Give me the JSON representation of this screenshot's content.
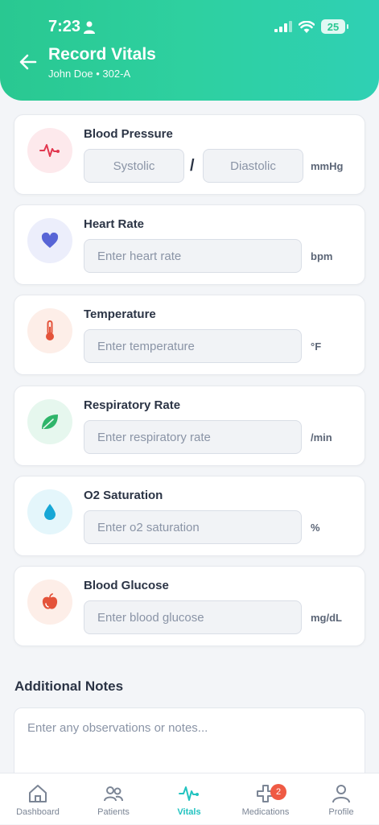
{
  "status_bar": {
    "time": "7:23",
    "battery": "25"
  },
  "header": {
    "title": "Record Vitals",
    "subtitle": "John Doe • 302-A"
  },
  "vitals": {
    "blood_pressure": {
      "label": "Blood Pressure",
      "systolic_placeholder": "Systolic",
      "diastolic_placeholder": "Diastolic",
      "separator": "/",
      "unit": "mmHg"
    },
    "heart_rate": {
      "label": "Heart Rate",
      "placeholder": "Enter heart rate",
      "unit": "bpm"
    },
    "temperature": {
      "label": "Temperature",
      "placeholder": "Enter temperature",
      "unit": "°F"
    },
    "respiratory_rate": {
      "label": "Respiratory Rate",
      "placeholder": "Enter respiratory rate",
      "unit": "/min"
    },
    "o2_saturation": {
      "label": "O2 Saturation",
      "placeholder": "Enter o2 saturation",
      "unit": "%"
    },
    "blood_glucose": {
      "label": "Blood Glucose",
      "placeholder": "Enter blood glucose",
      "unit": "mg/dL"
    }
  },
  "notes": {
    "title": "Additional Notes",
    "placeholder": "Enter any observations or notes..."
  },
  "tabs": {
    "dashboard": "Dashboard",
    "patients": "Patients",
    "vitals": "Vitals",
    "medications": "Medications",
    "medications_badge": "2",
    "profile": "Profile"
  }
}
